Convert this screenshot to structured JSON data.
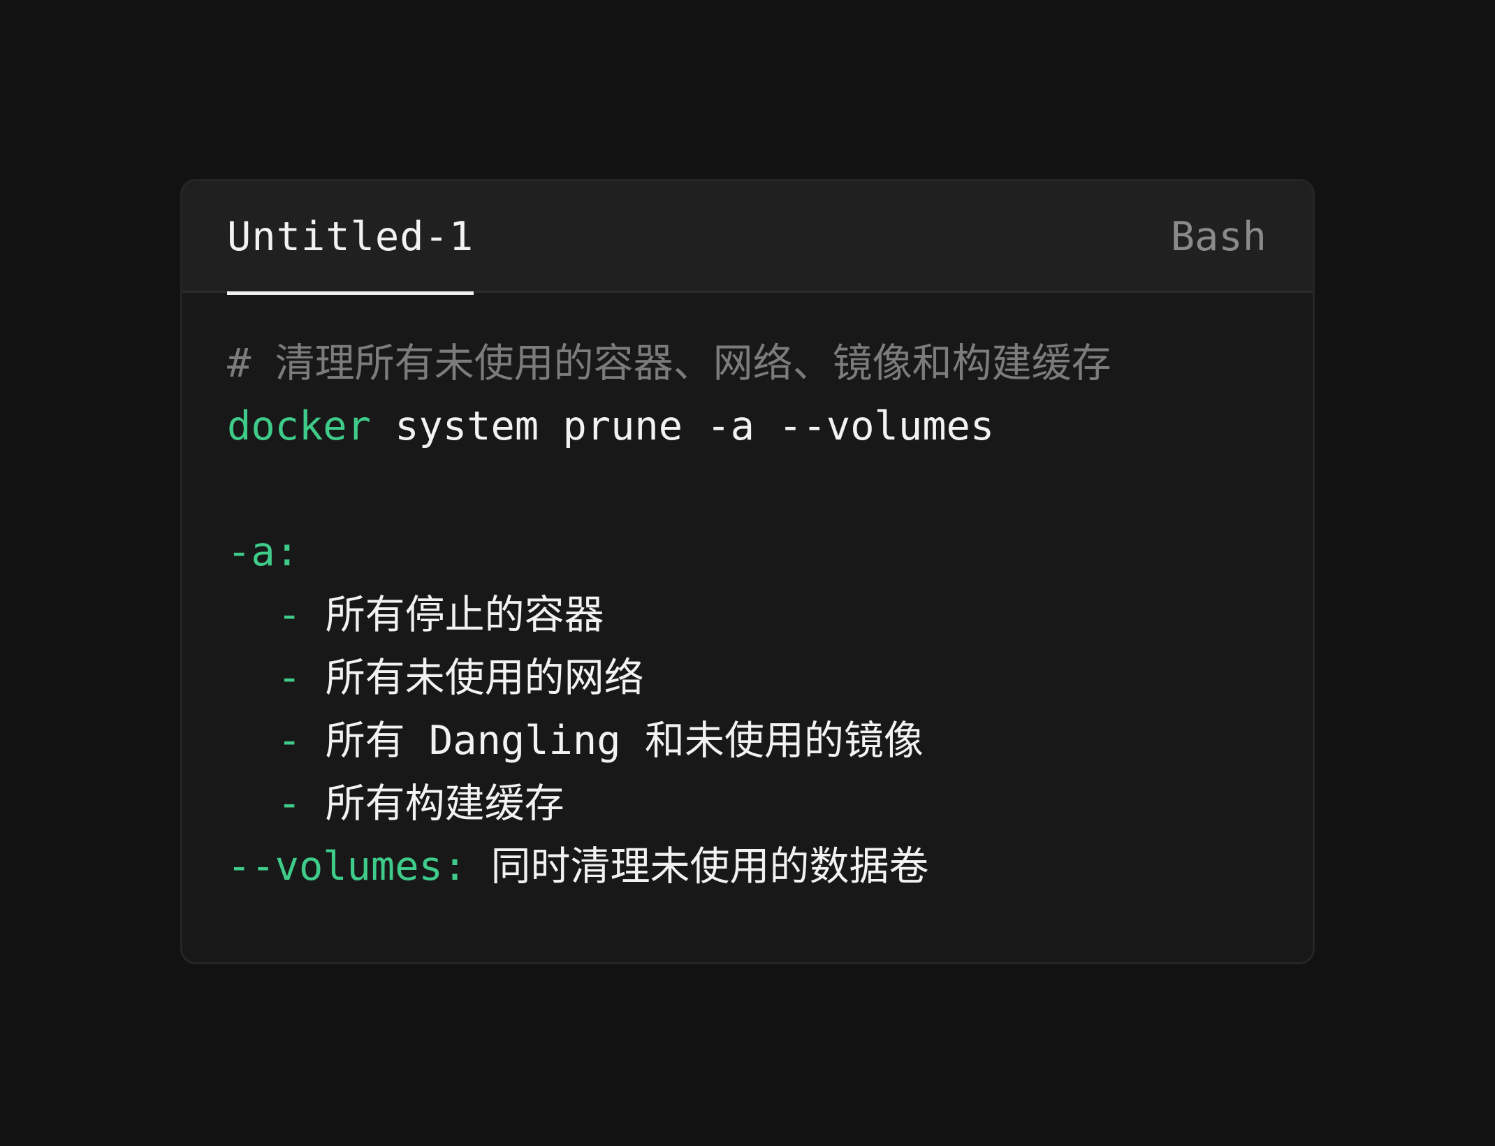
{
  "editor_window": {
    "tab_title": "Untitled-1",
    "language": "Bash"
  },
  "code": {
    "comment": "# 清理所有未使用的容器、网络、镜像和构建缓存",
    "command": {
      "keyword": "docker",
      "rest": " system prune -a --volumes"
    },
    "option_a": {
      "flag": "-a:",
      "bullet": "-",
      "items": [
        "所有停止的容器",
        "所有未使用的网络",
        "所有 Dangling 和未使用的镜像",
        "所有构建缓存"
      ]
    },
    "option_volumes": {
      "flag": "--volumes:",
      "description": " 同时清理未使用的数据卷"
    }
  },
  "colors": {
    "background": "#121212",
    "panel": "#181818",
    "titlebar": "#202020",
    "accent_green": "#3fcc8a",
    "comment_gray": "#7c7c7c",
    "text": "#f2f2f2"
  }
}
